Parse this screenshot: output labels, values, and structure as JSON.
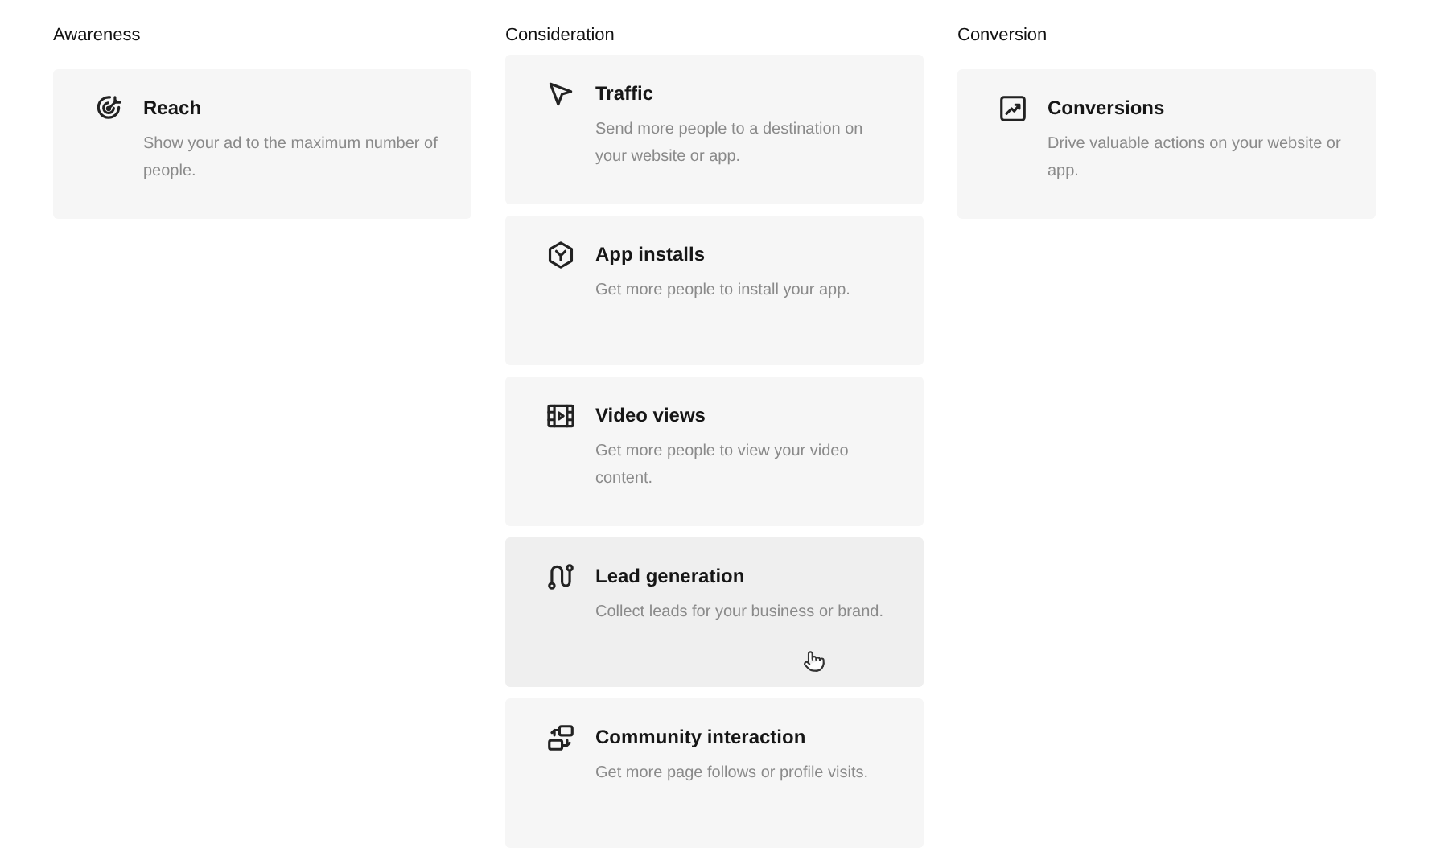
{
  "columns": [
    {
      "heading": "Awareness",
      "cards": [
        {
          "title": "Reach",
          "description": "Show your ad to the maximum number of people.",
          "hovered": false
        }
      ]
    },
    {
      "heading": "Consideration",
      "cards": [
        {
          "title": "Traffic",
          "description": "Send more people to a destination on your website or app.",
          "hovered": false
        },
        {
          "title": "App installs",
          "description": "Get more people to install your app.",
          "hovered": false
        },
        {
          "title": "Video views",
          "description": "Get more people to view your video content.",
          "hovered": false
        },
        {
          "title": "Lead generation",
          "description": "Collect leads for your business or brand.",
          "hovered": true
        },
        {
          "title": "Community interaction",
          "description": "Get more page follows or profile visits.",
          "hovered": false
        }
      ]
    },
    {
      "heading": "Conversion",
      "cards": [
        {
          "title": "Conversions",
          "description": "Drive valuable actions on your website or app.",
          "hovered": false
        }
      ]
    }
  ]
}
